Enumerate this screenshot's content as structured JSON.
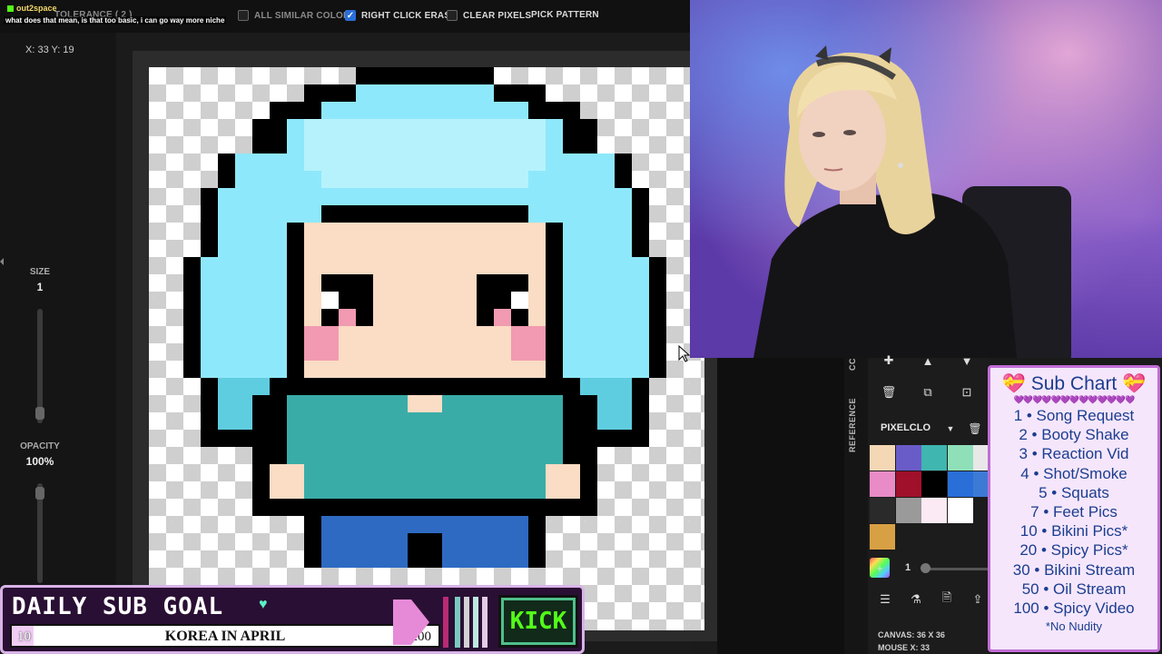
{
  "chat": {
    "username": "out2space",
    "message": "what does that mean, is that too basic, i can go way more niche"
  },
  "toolbar": {
    "tolerance_label": "TOLERANCE ( 2 )",
    "all_similar_colors_label": "ALL SIMILAR COLORS",
    "right_click_erase_label": "RIGHT CLICK ERASE",
    "clear_pixels_label": "CLEAR PIXELS",
    "pick_pattern_label": "PICK PATTERN"
  },
  "left_panel": {
    "coords": "X: 33 Y: 19",
    "size_label": "SIZE",
    "size_value": "1",
    "opacity_label": "OPACITY",
    "opacity_value": "100%"
  },
  "app_panel": {
    "tab_top": "CC",
    "tab_reference": "REFERENCE",
    "palette_name": "PIXELCLO",
    "brush_size": "1",
    "canvas_size": "CANVAS: 36 X 36",
    "mouse_pos": "MOUSE X: 33",
    "palette_colors": [
      "#f4d7b5",
      "#6a5cc8",
      "#3fb6b0",
      "#8fe0b8",
      "#e8e8e8",
      "#e98bc6",
      "#a0102a",
      "#000000",
      "#2a6ed8",
      "#3d7ad6",
      "#2a2a2a",
      "#9a9a9a",
      "#fbeaf4",
      "#ffffff",
      "",
      "#d8a044",
      "",
      "",
      "",
      ""
    ]
  },
  "sub_chart": {
    "title": "💝 Sub Chart 💝",
    "hearts": "💜💜💜💜💜💜💜💜💜💜💜💜💜",
    "items": [
      "1 • Song Request",
      "2 • Booty Shake",
      "3 • Reaction Vid",
      "4 • Shot/Smoke",
      "5 • Squats",
      "7 • Feet Pics",
      "10 • Bikini Pics*",
      "20 • Spicy Pics*",
      "30 • Bikini Stream",
      "50 • Oil Stream",
      "100 • Spicy Video"
    ],
    "footnote": "*No Nudity"
  },
  "sub_goal": {
    "title": "DAILY SUB GOAL",
    "start": "10",
    "name": "KOREA IN APRIL",
    "end": "200",
    "progress": 0.05,
    "platform": "KICK"
  },
  "colors": {
    "hair": "#8ee8fb",
    "hair_light": "#b6f2fc",
    "hair_dark": "#5fcde0",
    "skin": "#fbdcc4",
    "shirt": "#3aaca8",
    "pants": "#2e6ac2",
    "blush": "#f19ab1",
    "outline": "#000000"
  }
}
